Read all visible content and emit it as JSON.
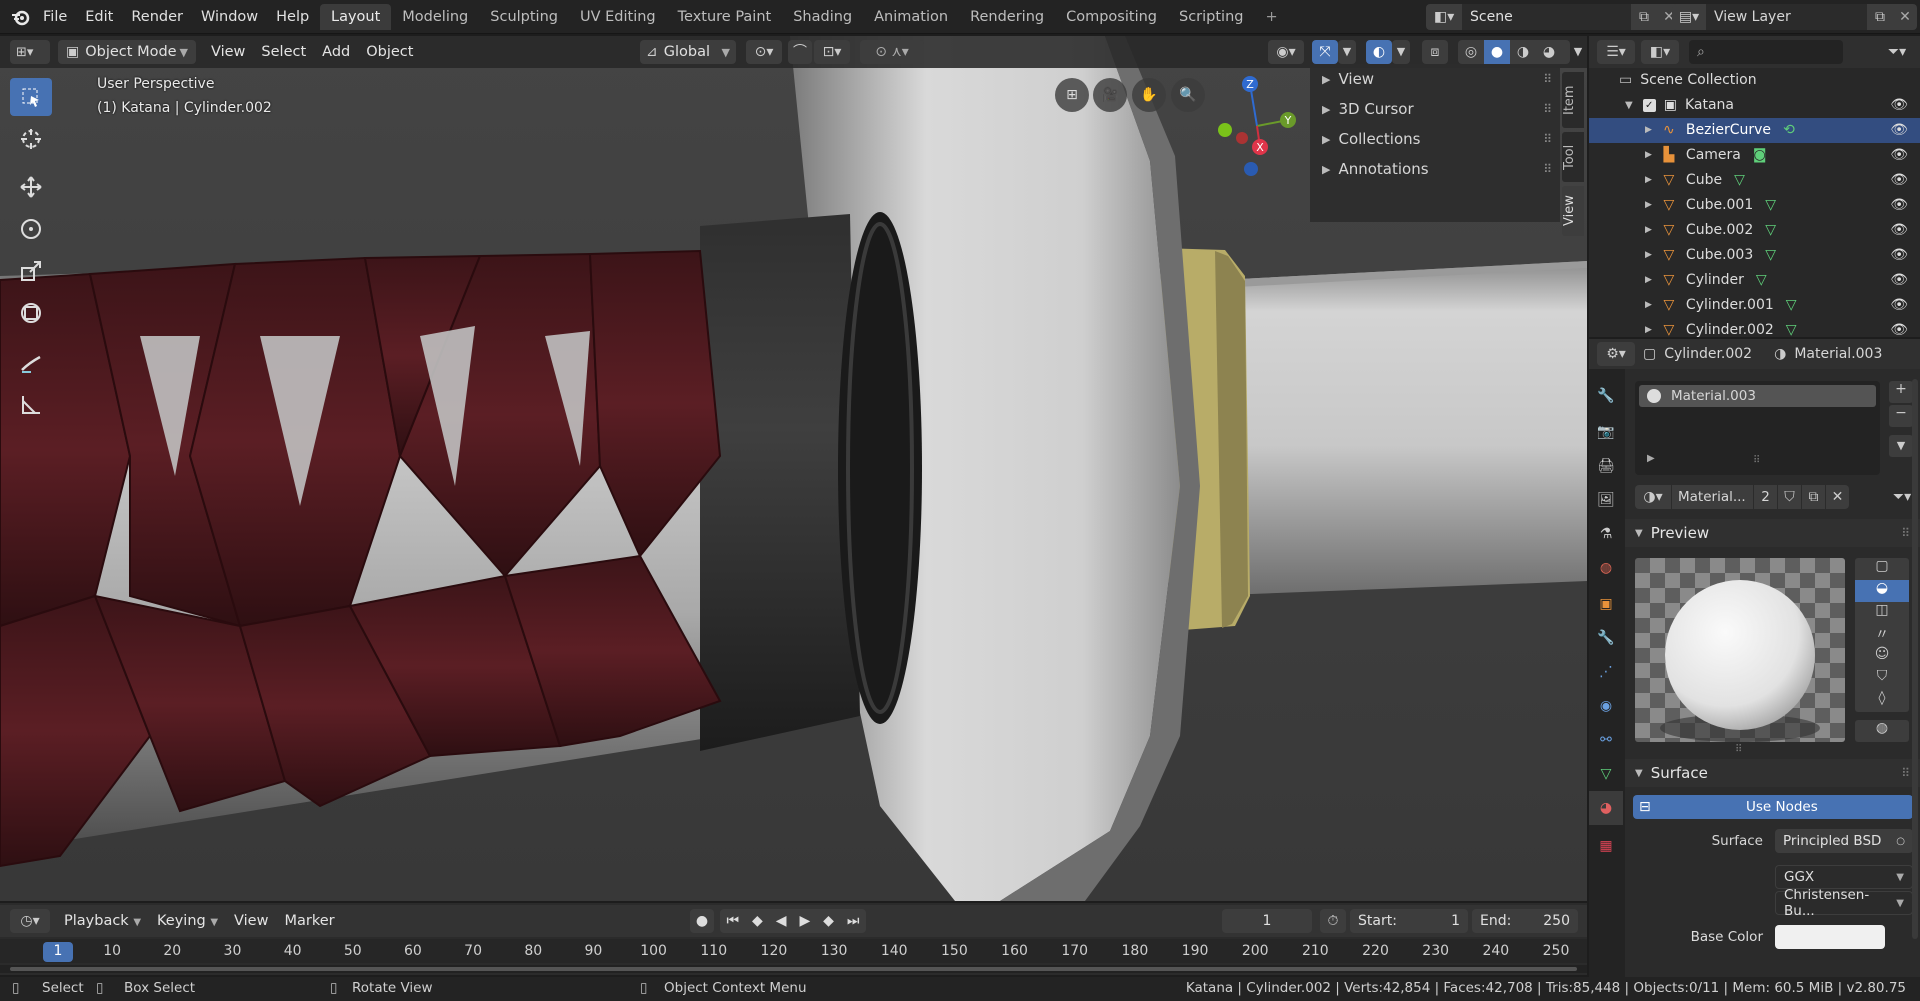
{
  "menu": {
    "file": "File",
    "edit": "Edit",
    "render": "Render",
    "window": "Window",
    "help": "Help"
  },
  "workspaces": [
    "Layout",
    "Modeling",
    "Sculpting",
    "UV Editing",
    "Texture Paint",
    "Shading",
    "Animation",
    "Rendering",
    "Compositing",
    "Scripting"
  ],
  "scene": {
    "name": "Scene",
    "view_layer": "View Layer"
  },
  "viewport": {
    "mode": "Object Mode",
    "menus": [
      "View",
      "Select",
      "Add",
      "Object"
    ],
    "orientation": "Global",
    "overlay_title": "User Perspective",
    "overlay_subtitle": "(1) Katana | Cylinder.002",
    "gizmo_axes": {
      "z": "Z",
      "x": "X",
      "y": "Y"
    }
  },
  "npanel": {
    "items": [
      "View",
      "3D Cursor",
      "Collections",
      "Annotations"
    ],
    "tabs": [
      "Item",
      "Tool",
      "View"
    ]
  },
  "outliner": {
    "search_placeholder": "",
    "scene_collection": "Scene Collection",
    "collection": "Katana",
    "objects": [
      {
        "name": "BezierCurve",
        "selected": true
      },
      {
        "name": "Camera",
        "selected": false
      },
      {
        "name": "Cube",
        "selected": false
      },
      {
        "name": "Cube.001",
        "selected": false
      },
      {
        "name": "Cube.002",
        "selected": false
      },
      {
        "name": "Cube.003",
        "selected": false
      },
      {
        "name": "Cylinder",
        "selected": false
      },
      {
        "name": "Cylinder.001",
        "selected": false
      },
      {
        "name": "Cylinder.002",
        "selected": false
      }
    ]
  },
  "properties": {
    "object_name": "Cylinder.002",
    "material_name": "Material.003",
    "slot_name": "Material.003",
    "material_short": "Material...",
    "user_count": "2",
    "preview_title": "Preview",
    "surface_title": "Surface",
    "use_nodes": "Use Nodes",
    "surface_label": "Surface",
    "surface_value": "Principled BSD",
    "distribution": "GGX",
    "subsurface": "Christensen-Bu...",
    "base_color_label": "Base Color"
  },
  "timeline": {
    "menus": [
      "Playback",
      "Keying",
      "View",
      "Marker"
    ],
    "current_frame": "1",
    "start_label": "Start:",
    "start": "1",
    "end_label": "End:",
    "end": "250",
    "ruler": [
      "1",
      "10",
      "20",
      "30",
      "40",
      "50",
      "60",
      "70",
      "80",
      "90",
      "100",
      "110",
      "120",
      "130",
      "140",
      "150",
      "160",
      "170",
      "180",
      "190",
      "200",
      "210",
      "220",
      "230",
      "240",
      "250"
    ]
  },
  "statusbar": {
    "select": "Select",
    "box_select": "Box Select",
    "rotate_view": "Rotate View",
    "context_menu": "Object Context Menu",
    "stats": "Katana | Cylinder.002 | Verts:42,854 | Faces:42,708 | Tris:85,448 | Objects:0/11 | Mem: 60.5 MiB | v2.80.75"
  },
  "colors": {
    "accent": "#4772b3",
    "selected_row": "#334d80",
    "wrap": "#4a1a1e",
    "guard": "#c7c7c7",
    "habaki": "#b5a965"
  }
}
